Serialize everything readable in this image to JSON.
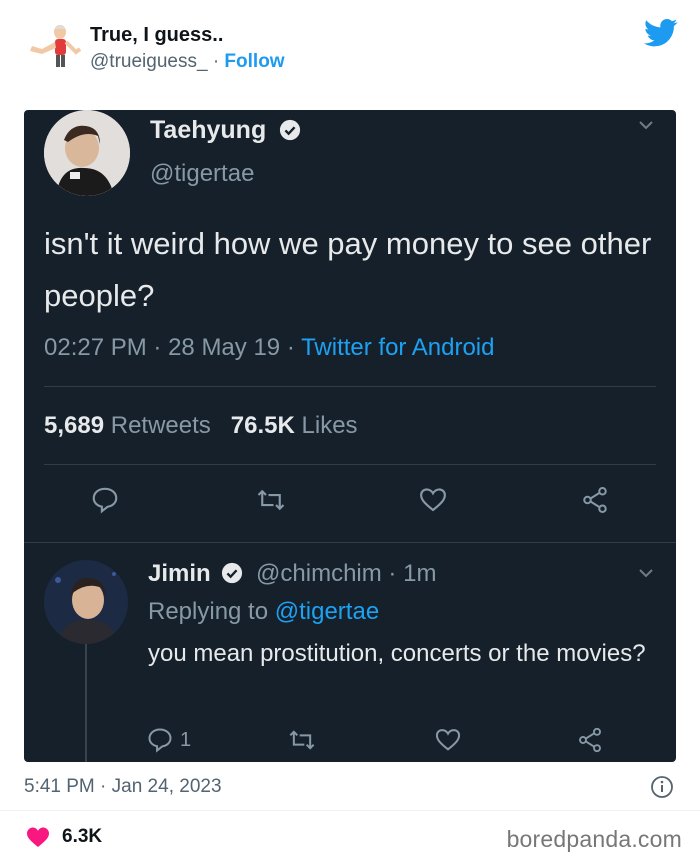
{
  "author": {
    "name": "True, I guess..",
    "handle": "@trueiguess_",
    "separator": "·",
    "follow_label": "Follow"
  },
  "embedded": {
    "tweet": {
      "name": "Taehyung",
      "handle": "@tigertae",
      "text": "isn't it weird how we pay money to see other people?",
      "time": "02:27 PM",
      "date": "28 May 19",
      "source": "Twitter for Android",
      "retweets_count": "5,689",
      "retweets_label": "Retweets",
      "likes_count": "76.5K",
      "likes_label": "Likes"
    },
    "reply": {
      "name": "Jimin",
      "handle": "@chimchim",
      "age": "1m",
      "replying_prefix": "Replying to",
      "replying_to": "@tigertae",
      "text": "you mean prostitution, concerts or the movies?",
      "reply_count": "1"
    }
  },
  "timestamp": "5:41 PM · Jan 24, 2023",
  "likes_count": "6.3K",
  "brand": "boredpanda.com",
  "colors": {
    "accent": "#1d9bf0",
    "heart": "#f91880",
    "dark_bg": "#15202b"
  }
}
